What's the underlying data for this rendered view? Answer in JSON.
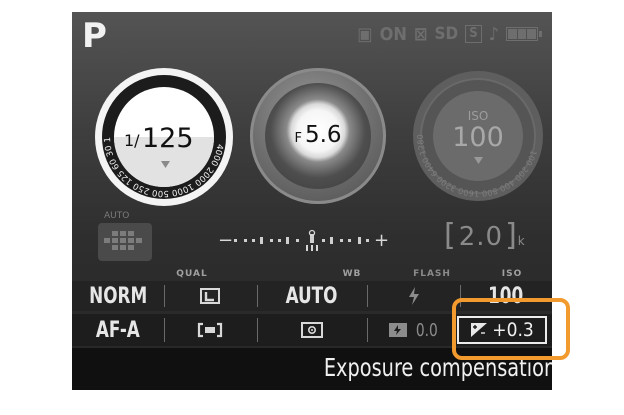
{
  "mode": "P",
  "status": {
    "onboard": "ON",
    "card": "SD",
    "card_slot": "S"
  },
  "shutter": {
    "prefix": "1/",
    "value": "125",
    "scale": [
      "4000",
      "2000",
      "1000",
      "500",
      "250",
      "125",
      "60",
      "30",
      "15",
      "8",
      "4",
      "2",
      "1\""
    ]
  },
  "aperture": {
    "prefix": "F",
    "value": "5.6"
  },
  "iso_dial": {
    "label": "ISO",
    "value": "100",
    "scale": [
      "100",
      "200",
      "400",
      "800",
      "1600",
      "3200",
      "6400",
      "12800",
      "H1"
    ]
  },
  "af_area": {
    "label": "AUTO"
  },
  "meter": {
    "minus": "−",
    "plus": "+"
  },
  "bracketing": {
    "value": "2.0",
    "unit": "k"
  },
  "info_panel": {
    "labels": [
      "",
      "QUAL",
      "",
      "WB",
      "FLASH",
      "ISO"
    ],
    "row1": [
      "NORM",
      "",
      "",
      "AUTO",
      "",
      "100"
    ],
    "row2": [
      "AF-A",
      "",
      "",
      "",
      "0.0",
      "+0.3"
    ]
  },
  "hint_text": "Exposure compensation",
  "colors": {
    "highlight": "#f29a2e"
  }
}
